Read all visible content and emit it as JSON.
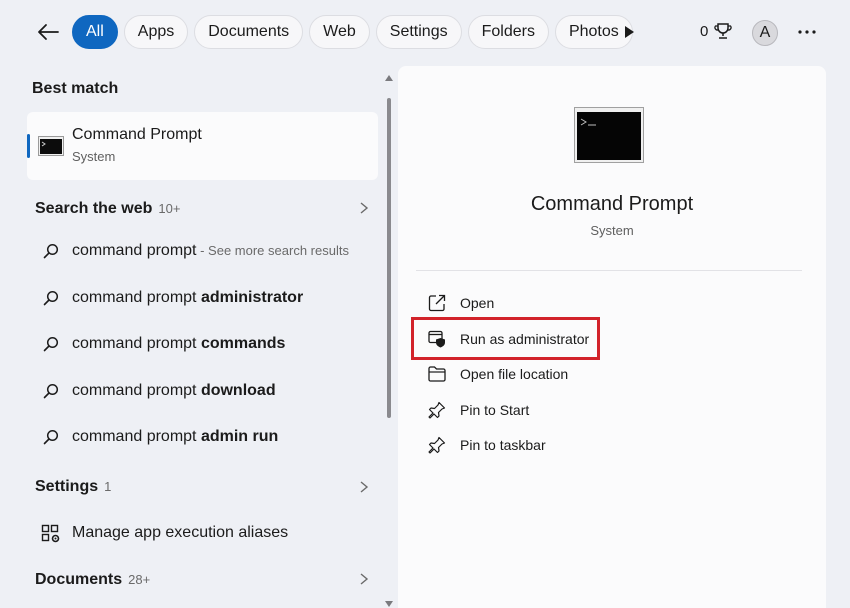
{
  "topbar": {
    "back_icon": "arrow-left-icon",
    "filters": [
      {
        "label": "All",
        "active": true
      },
      {
        "label": "Apps",
        "active": false
      },
      {
        "label": "Documents",
        "active": false
      },
      {
        "label": "Web",
        "active": false
      },
      {
        "label": "Settings",
        "active": false
      },
      {
        "label": "Folders",
        "active": false
      },
      {
        "label": "Photos",
        "active": false
      }
    ],
    "play_icon": "play-icon",
    "points": "0",
    "avatar_initial": "A",
    "more_icon": "more-horizontal-icon"
  },
  "left": {
    "best_match": {
      "header": "Best match",
      "title": "Command Prompt",
      "subtitle": "System"
    },
    "search_web": {
      "header": "Search the web",
      "count": "10+",
      "results": [
        {
          "prefix": "command prompt",
          "bold": "",
          "hint": " - See more search results"
        },
        {
          "prefix": "command prompt ",
          "bold": "administrator",
          "hint": ""
        },
        {
          "prefix": "command prompt ",
          "bold": "commands",
          "hint": ""
        },
        {
          "prefix": "command prompt ",
          "bold": "download",
          "hint": ""
        },
        {
          "prefix": "command prompt ",
          "bold": "admin run",
          "hint": ""
        }
      ]
    },
    "settings": {
      "header": "Settings",
      "count": "1",
      "item": "Manage app execution aliases"
    },
    "documents": {
      "header": "Documents",
      "count": "28+"
    }
  },
  "right": {
    "title": "Command Prompt",
    "subtitle": "System",
    "actions": [
      {
        "label": "Open",
        "icon": "open-external-icon"
      },
      {
        "label": "Run as administrator",
        "icon": "shield-window-icon"
      },
      {
        "label": "Open file location",
        "icon": "folder-icon"
      },
      {
        "label": "Pin to Start",
        "icon": "pin-icon"
      },
      {
        "label": "Pin to taskbar",
        "icon": "pin-icon"
      }
    ]
  },
  "colors": {
    "accent": "#0f67c0",
    "highlight": "#d2232a",
    "background": "#eef0f5",
    "card": "#fbfbfc"
  }
}
